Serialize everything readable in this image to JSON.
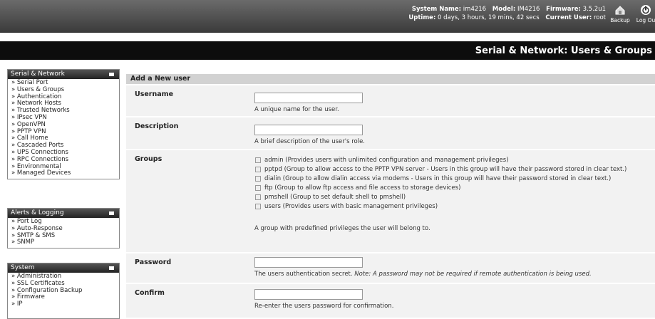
{
  "header": {
    "system_name_label": "System Name:",
    "system_name": "im4216",
    "model_label": "Model:",
    "model": "IM4216",
    "firmware_label": "Firmware:",
    "firmware": "3.5.2u1",
    "uptime_label": "Uptime:",
    "uptime": "0 days, 3 hours, 19 mins, 42 secs",
    "current_user_label": "Current User:",
    "current_user": "root",
    "backup_label": "Backup",
    "logout_label": "Log Ou"
  },
  "page_title": "Serial & Network: Users & Groups",
  "sidebar": {
    "sections": [
      {
        "title": "Serial & Network",
        "items": [
          "Serial Port",
          "Users & Groups",
          "Authentication",
          "Network Hosts",
          "Trusted Networks",
          "IPsec VPN",
          "OpenVPN",
          "PPTP VPN",
          "Call Home",
          "Cascaded Ports",
          "UPS Connections",
          "RPC Connections",
          "Environmental",
          "Managed Devices"
        ]
      },
      {
        "title": "Alerts & Logging",
        "items": [
          "Port Log",
          "Auto-Response",
          "SMTP & SMS",
          "SNMP"
        ]
      },
      {
        "title": "System",
        "items": [
          "Administration",
          "SSL Certificates",
          "Configuration Backup",
          "Firmware",
          "IP"
        ]
      }
    ]
  },
  "form": {
    "heading": "Add a New user",
    "username": {
      "label": "Username",
      "value": "",
      "help": "A unique name for the user."
    },
    "description": {
      "label": "Description",
      "value": "",
      "help": "A brief description of the user's role."
    },
    "groups": {
      "label": "Groups",
      "options": [
        "admin (Provides users with unlimited configuration and management privileges)",
        "pptpd (Group to allow access to the PPTP VPN server - Users in this group will have their password stored in clear text.)",
        "dialin (Group to allow dialin access via modems - Users in this group will have their password stored in clear text.)",
        "ftp (Group to allow ftp access and file access to storage devices)",
        "pmshell (Group to set default shell to pmshell)",
        "users (Provides users with basic management privileges)"
      ],
      "help": "A group with predefined privileges the user will belong to."
    },
    "password": {
      "label": "Password",
      "value": "",
      "help": "The users authentication secret.",
      "note": "Note: A password may not be required if remote authentication is being used."
    },
    "confirm": {
      "label": "Confirm",
      "value": "",
      "help": "Re-enter the users password for confirmation."
    }
  }
}
